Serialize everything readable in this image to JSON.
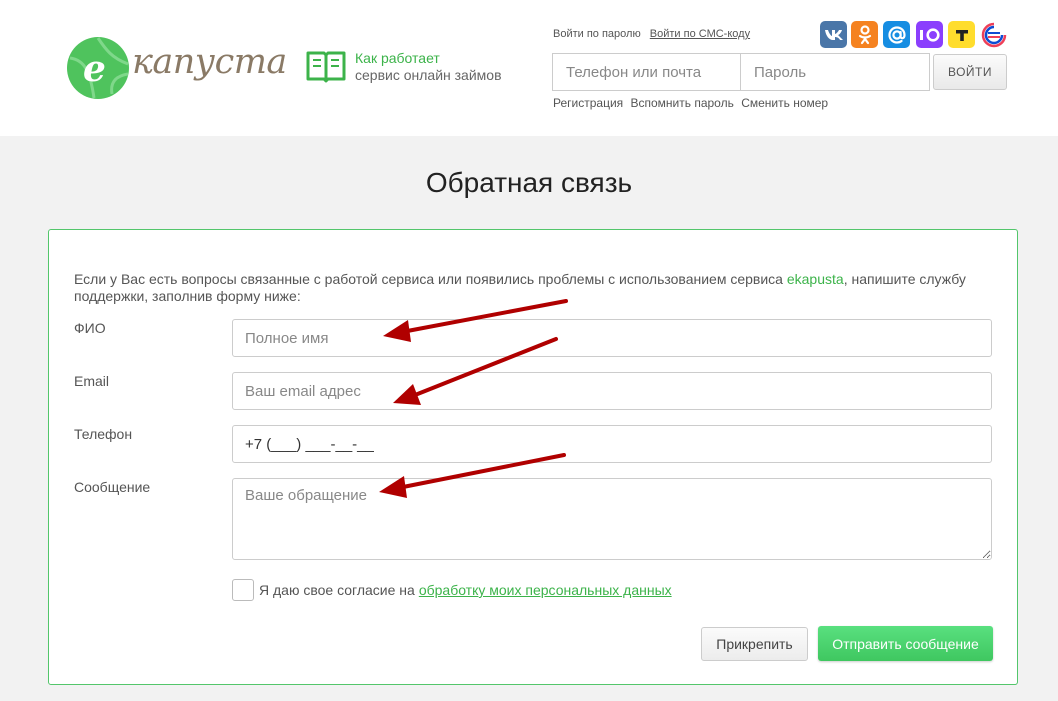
{
  "header": {
    "logo_text": "капуста",
    "logo_letter": "e",
    "how_line1": "Как работает",
    "how_line2": "сервис онлайн займов",
    "login_tab_password": "Войти по паролю",
    "login_tab_sms": "Войти по СМС-коду",
    "phone_placeholder": "Телефон или почта",
    "password_placeholder": "Пароль",
    "login_button": "ВОЙТИ",
    "links": [
      "Регистрация",
      "Вспомнить пароль",
      "Сменить номер"
    ],
    "socials": [
      {
        "icon": "vk-icon",
        "glyph": "vk",
        "color": "#4a76a8"
      },
      {
        "icon": "odnoklassniki-icon",
        "glyph": "ок",
        "color": "#f58220"
      },
      {
        "icon": "mail-ru-icon",
        "glyph": "@",
        "color": "#168de2"
      },
      {
        "icon": "yoomoney-icon",
        "glyph": "ю",
        "color": "#8b3ffd"
      },
      {
        "icon": "tinkoff-icon",
        "glyph": "Т",
        "color": "#ffdd2d"
      },
      {
        "icon": "gosuslugi-icon",
        "glyph": "",
        "color": "#ffffff"
      }
    ]
  },
  "page": {
    "title": "Обратная связь"
  },
  "form": {
    "intro_prefix": "Если у Вас есть вопросы связанные с работой сервиса или появились проблемы с использованием сервиса ",
    "intro_brand": "ekapusta",
    "intro_suffix": ", напишите службу поддержки, заполнив форму ниже:",
    "fio_label": "ФИО",
    "fio_placeholder": "Полное имя",
    "email_label": "Email",
    "email_placeholder": "Ваш email адрес",
    "phone_label": "Телефон",
    "phone_value": "+7 (___) ___-__-__",
    "message_label": "Сообщение",
    "message_placeholder": "Ваше обращение",
    "consent_text": "Я даю свое согласие на",
    "consent_link": "обработку моих персональных данных",
    "attach_button": "Прикрепить",
    "send_button": "Отправить сообщение"
  },
  "colors": {
    "brand_green": "#3cb34a",
    "button_green": "#4cd26f",
    "arrow_red": "#b00000"
  }
}
